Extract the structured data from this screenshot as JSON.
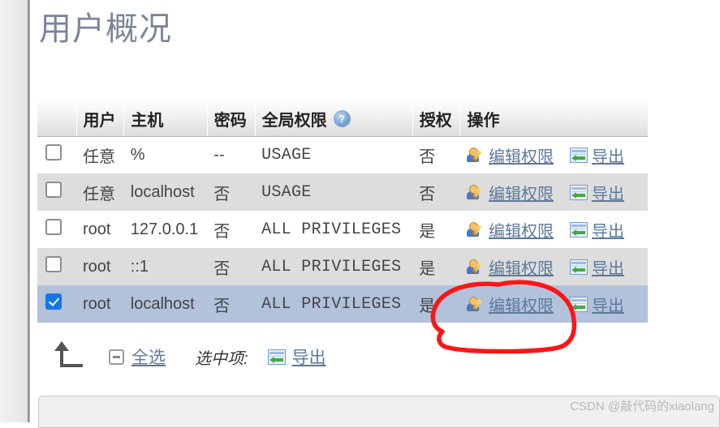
{
  "page": {
    "title": "用户概况"
  },
  "table": {
    "headers": [
      {
        "label": "",
        "name": "select-column"
      },
      {
        "label": "用户",
        "name": "user-column"
      },
      {
        "label": "主机",
        "name": "host-column"
      },
      {
        "label": "密码",
        "name": "password-column"
      },
      {
        "label": "全局权限",
        "name": "global-privileges-column",
        "help_icon": "?"
      },
      {
        "label": "授权",
        "name": "grant-column"
      },
      {
        "label": "操作",
        "name": "actions-column"
      }
    ],
    "rows": [
      {
        "checked": false,
        "user": "任意",
        "user_red": true,
        "host": "%",
        "password": "--",
        "password_red": false,
        "privileges": "USAGE",
        "grant": "否",
        "edit_label": "编辑权限",
        "export_label": "导出"
      },
      {
        "checked": false,
        "user": "任意",
        "user_red": true,
        "host": "localhost",
        "password": "否",
        "password_red": true,
        "privileges": "USAGE",
        "grant": "否",
        "edit_label": "编辑权限",
        "export_label": "导出"
      },
      {
        "checked": false,
        "user": "root",
        "user_red": false,
        "host": "127.0.0.1",
        "password": "否",
        "password_red": true,
        "privileges": "ALL PRIVILEGES",
        "grant": "是",
        "edit_label": "编辑权限",
        "export_label": "导出"
      },
      {
        "checked": false,
        "user": "root",
        "user_red": false,
        "host": "::1",
        "password": "否",
        "password_red": true,
        "privileges": "ALL PRIVILEGES",
        "grant": "是",
        "edit_label": "编辑权限",
        "export_label": "导出"
      },
      {
        "checked": true,
        "user": "root",
        "user_red": false,
        "host": "localhost",
        "password": "否",
        "password_red": true,
        "privileges": "ALL PRIVILEGES",
        "grant": "是",
        "edit_label": "编辑权限",
        "export_label": "导出"
      }
    ]
  },
  "footer": {
    "select_all_label": "全选",
    "with_selected_label": "选中项:",
    "export_label": "导出"
  },
  "watermark": {
    "text": "CSDN @敲代码的xiaolang"
  },
  "colors": {
    "title": "#7b8697",
    "link": "#5c7a9c",
    "danger": "#f33a22",
    "selected_row": "#b2c2db",
    "checkbox_checked": "#1477e8",
    "annotation": "#fa1616"
  }
}
